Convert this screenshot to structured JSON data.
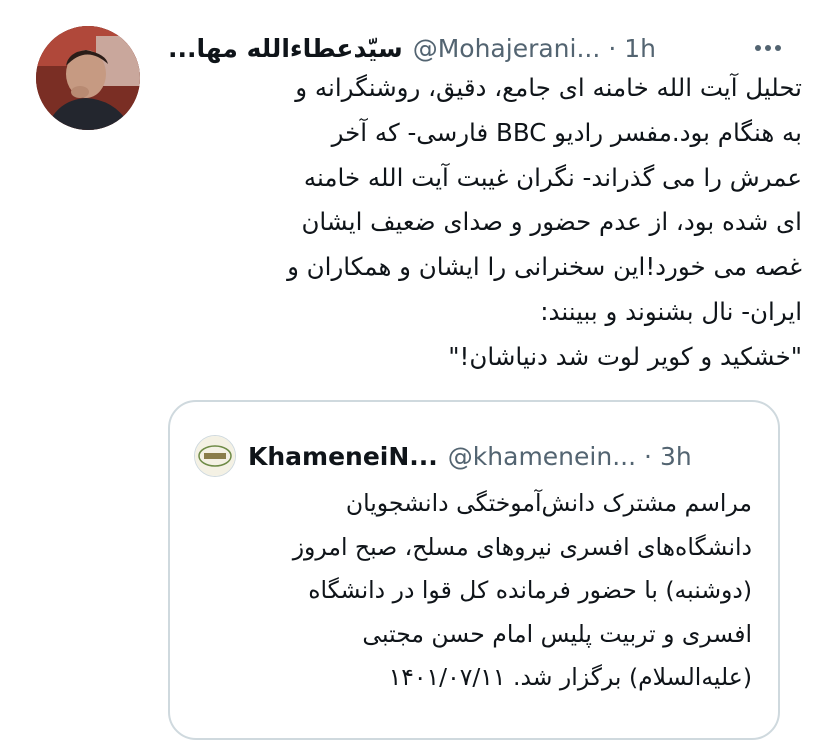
{
  "tweet": {
    "author_name": "سیّدعطاءالله مها...",
    "author_handle": "@Mohajerani...",
    "separator": "·",
    "time": "1h",
    "more_icon": "more-horizontal-icon",
    "body_lines": [
      "تحلیل آیت الله خامنه ای جامع، دقیق، روشنگرانه و",
      "به هنگام بود.مفسر رادیو BBC فارسی- که آخر",
      "عمرش را می گذراند- نگران غیبت آیت الله خامنه",
      "ای شده بود، از عدم حضور و صدای ضعیف ایشان",
      "غصه می خورد!این سخنرانی را ایشان و همکاران و",
      "ایران- نال بشنوند و ببینند:",
      "\"خشکید و کویر لوت شد دنیاشان!\""
    ]
  },
  "quoted_tweet": {
    "author_name": "KhameneiN...",
    "author_handle": "@khamenein...",
    "separator": "·",
    "time": "3h",
    "body_lines": [
      "مراسم مشترک دانش‌آموختگی دانشجویان",
      "دانشگاه‌های افسری نیروهای مسلح، صبح امروز",
      "(دوشنبه) با حضور فرمانده کل قوا در دانشگاه",
      "افسری و تربیت پلیس امام حسن مجتبی",
      "(علیه‌السلام) برگزار شد. ۱۴۰۱/۰۷/۱۱"
    ]
  }
}
